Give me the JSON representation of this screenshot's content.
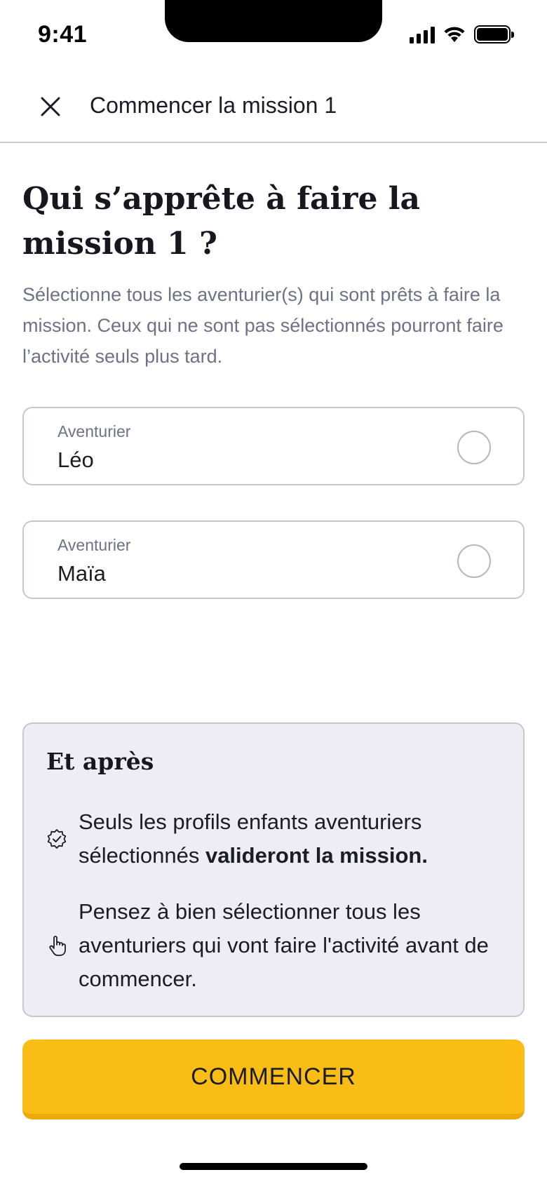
{
  "status_bar": {
    "time": "9:41"
  },
  "nav": {
    "title": "Commencer la mission 1"
  },
  "heading": "Qui s’apprête à faire la mission 1 ?",
  "description": "Sélectionne tous les aventurier(s) qui sont prêts à faire la mission. Ceux qui ne sont pas sélectionnés pourront faire l’activité seuls plus tard.",
  "adventurers": [
    {
      "label": "Aventurier",
      "name": "Léo",
      "selected": false
    },
    {
      "label": "Aventurier",
      "name": "Maïa",
      "selected": false
    }
  ],
  "info": {
    "title": "Et après",
    "items": [
      {
        "icon": "verified-badge-icon",
        "text_before": "Seuls les profils enfants aventuriers sélectionnés ",
        "text_bold": "valideront la mission."
      },
      {
        "icon": "hand-pointer-icon",
        "text": "Pensez à bien sélectionner tous les aventuriers qui vont faire l'activité avant de commencer."
      }
    ]
  },
  "cta": {
    "label": "COMMENCER"
  },
  "colors": {
    "accent": "#f9bd16",
    "info_bg": "#ededf3",
    "border": "#c6c6d4",
    "muted_text": "#6e7187"
  }
}
